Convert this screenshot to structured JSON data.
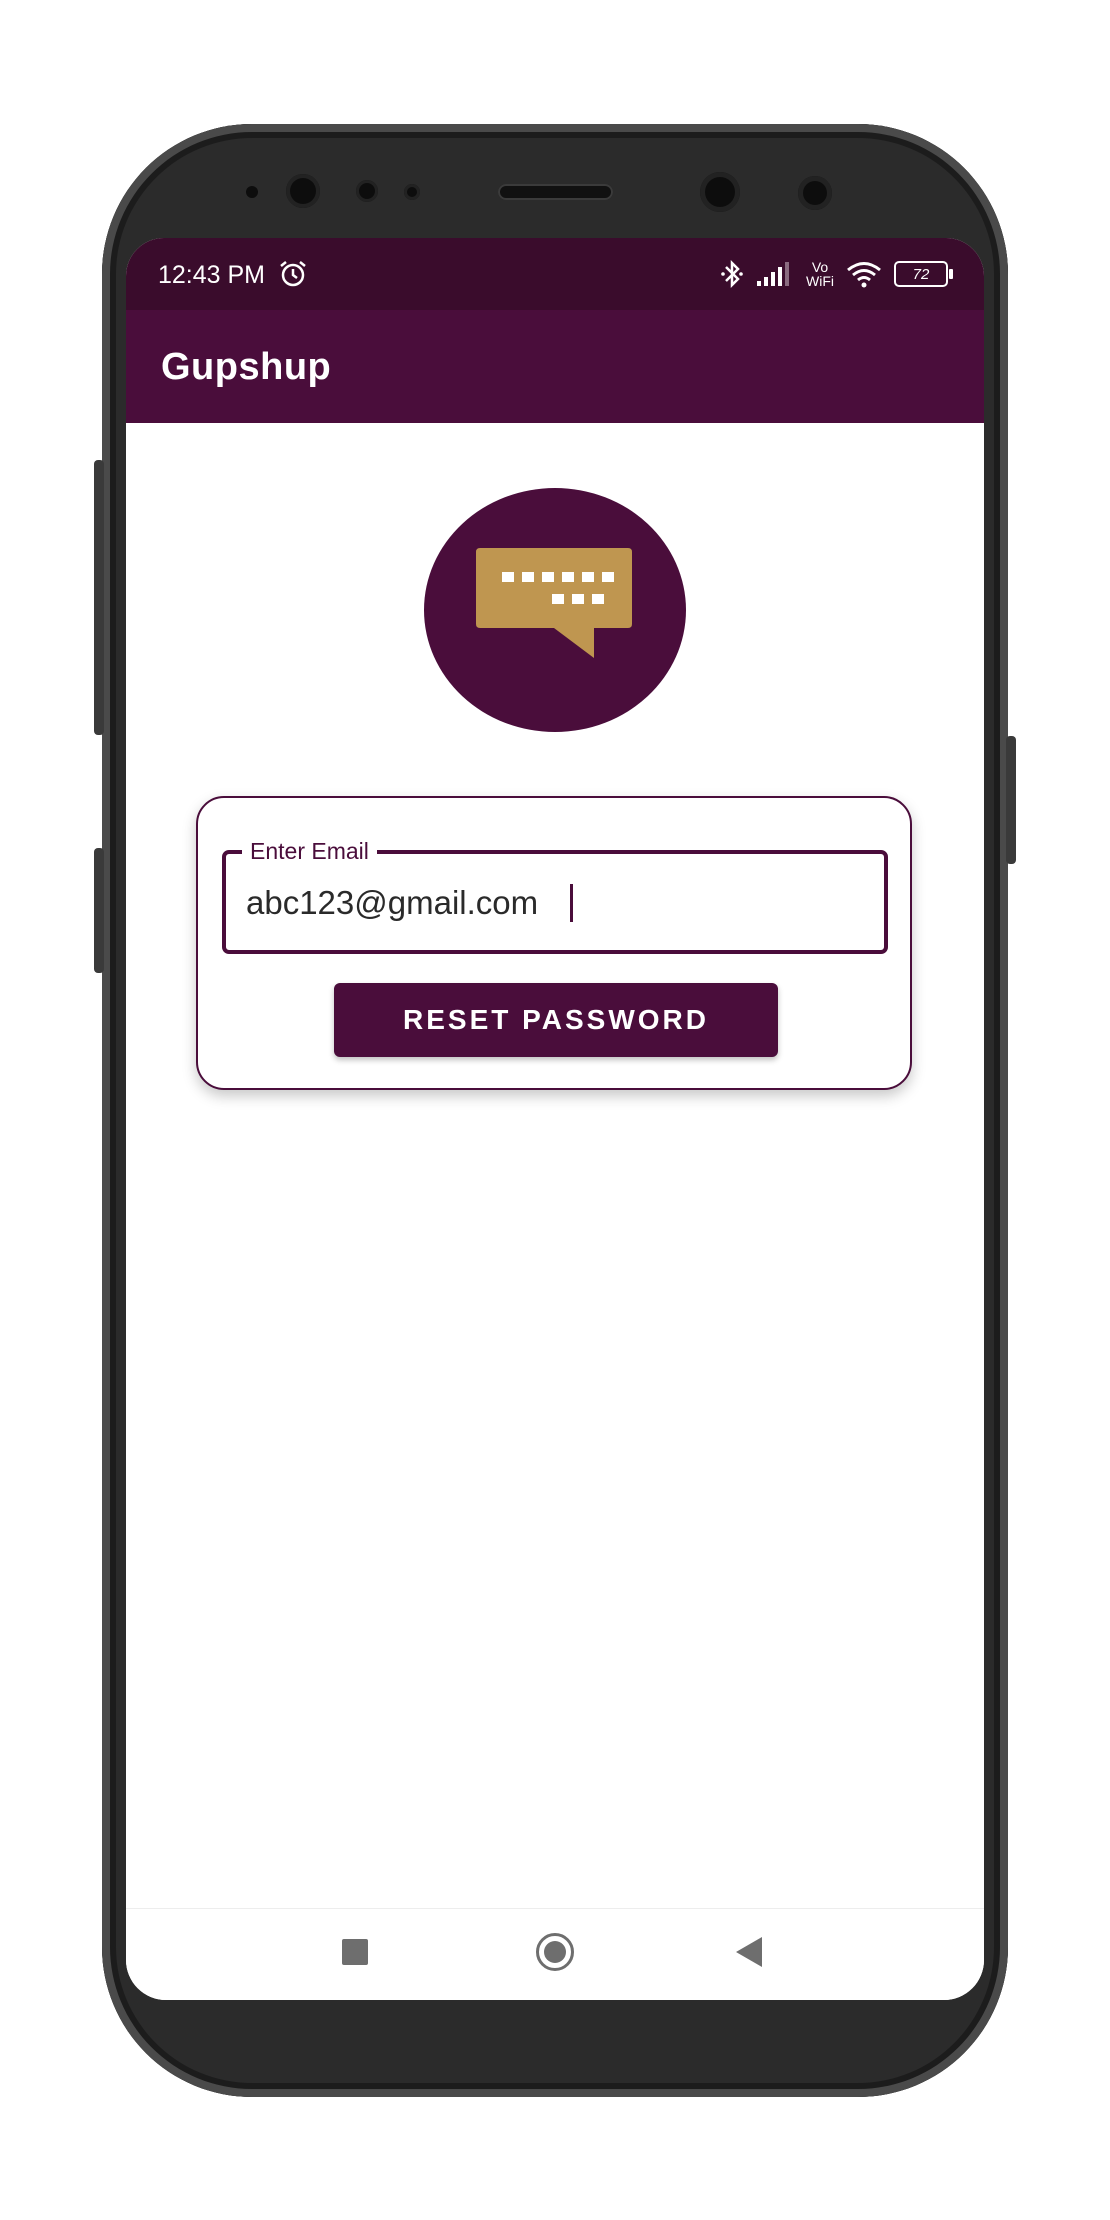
{
  "status_bar": {
    "time": "12:43 PM",
    "vowifi_top": "Vo",
    "vowifi_bottom": "WiFi",
    "battery": "72"
  },
  "app_bar": {
    "title": "Gupshup"
  },
  "logo": {
    "icon": "chat-keyboard-icon"
  },
  "form": {
    "email_label": "Enter Email",
    "email_value": "abc123@gmail.com",
    "reset_button": "RESET PASSWORD"
  },
  "nav": {
    "recent": "square-icon",
    "home": "circle-icon",
    "back": "triangle-back-icon"
  },
  "colors": {
    "primary": "#4a0d3b",
    "status_bar": "#3a0c2c",
    "logo_bubble": "#bf9650",
    "background": "#ffffff"
  }
}
